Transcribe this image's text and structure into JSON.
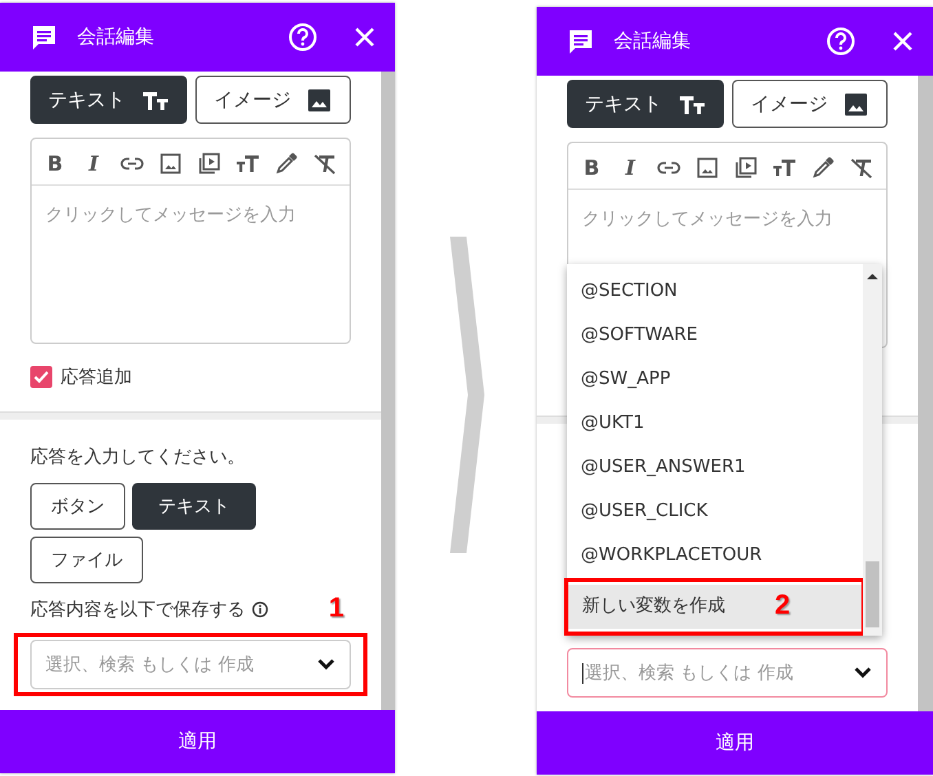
{
  "panels": [
    {
      "title": "会話編集",
      "content_tabs": [
        {
          "label": "テキスト",
          "selected": true
        },
        {
          "label": "イメージ",
          "selected": false
        }
      ],
      "toolbar": [
        {
          "kind": "bold",
          "glyph": "B"
        },
        {
          "kind": "italic",
          "glyph": "I"
        },
        {
          "kind": "link"
        },
        {
          "kind": "image"
        },
        {
          "kind": "video"
        },
        {
          "kind": "text_size"
        },
        {
          "kind": "color_picker"
        },
        {
          "kind": "clear_format"
        }
      ],
      "editor": {
        "placeholder": "クリックしてメッセージを入力"
      },
      "add_response": {
        "label": "応答追加",
        "checked": true
      },
      "response": {
        "prompt": "応答を入力してください。",
        "types": [
          {
            "label": "ボタン",
            "selected": false
          },
          {
            "label": "テキスト",
            "selected": true
          },
          {
            "label": "ファイル",
            "selected": false
          }
        ]
      },
      "save_as": {
        "label": "応答内容を以下で保存する",
        "placeholder": "選択、検索 もしくは 作成",
        "focused": false,
        "callout": {
          "number": "1"
        }
      },
      "apply_button": "適用"
    },
    {
      "title": "会話編集",
      "content_tabs": [
        {
          "label": "テキスト",
          "selected": true
        },
        {
          "label": "イメージ",
          "selected": false
        }
      ],
      "toolbar": [
        {
          "kind": "bold",
          "glyph": "B"
        },
        {
          "kind": "italic",
          "glyph": "I"
        },
        {
          "kind": "link"
        },
        {
          "kind": "image"
        },
        {
          "kind": "video"
        },
        {
          "kind": "text_size"
        },
        {
          "kind": "color_picker"
        },
        {
          "kind": "clear_format"
        }
      ],
      "editor": {
        "placeholder": "クリックしてメッセージを入力"
      },
      "dropdown": {
        "options": [
          {
            "label": "@SECTION",
            "selected": false
          },
          {
            "label": "@SOFTWARE",
            "selected": false
          },
          {
            "label": "@SW_APP",
            "selected": false
          },
          {
            "label": "@UKT1",
            "selected": false
          },
          {
            "label": "@USER_ANSWER1",
            "selected": false
          },
          {
            "label": "@USER_CLICK",
            "selected": false
          },
          {
            "label": "@WORKPLACETOUR",
            "selected": false
          },
          {
            "label": "新しい変数を作成",
            "selected": true,
            "callout": {
              "number": "2"
            }
          }
        ]
      },
      "save_as": {
        "placeholder": "選択、検索 もしくは 作成",
        "focused": true
      },
      "apply_button": "適用"
    }
  ]
}
